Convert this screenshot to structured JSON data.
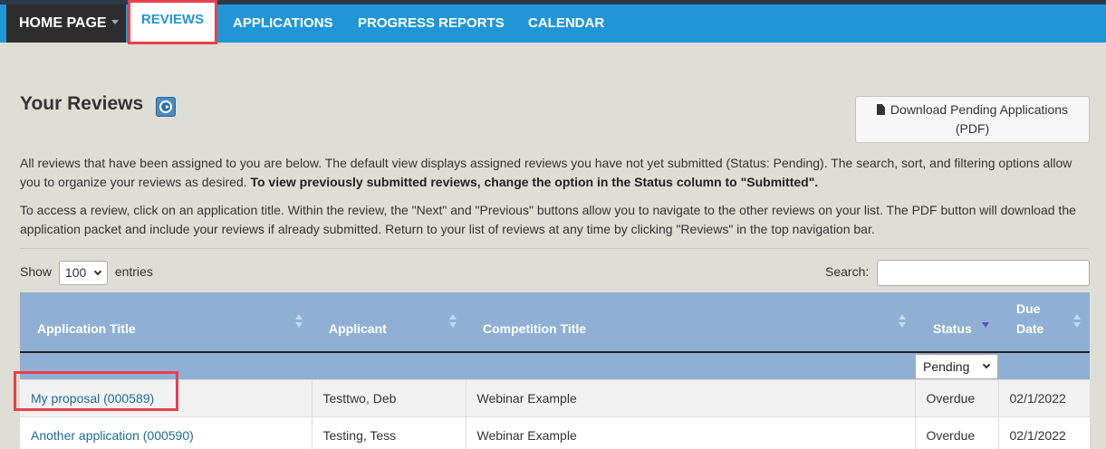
{
  "nav": {
    "home_label": "HOME PAGE",
    "items": [
      "REVIEWS",
      "APPLICATIONS",
      "PROGRESS REPORTS",
      "CALENDAR"
    ]
  },
  "page": {
    "title": "Your Reviews",
    "download_button": {
      "line1": "Download Pending Applications",
      "line2": "(PDF)"
    },
    "para1_text": "All reviews that have been assigned to you are below. The default view displays assigned reviews you have not yet submitted (Status: Pending). The search, sort, and filtering options allow you to organize your reviews as desired. ",
    "para1_bold": "To view previously submitted reviews, change the option in the Status column to \"Submitted\".",
    "para2_text": "To access a review, click on an application title. Within the review, the \"Next\" and \"Previous\" buttons allow you to navigate to the other reviews on your list. The PDF button will download the application packet and include your reviews if already submitted. Return to your list of reviews at any time by clicking \"Reviews\" in the top navigation bar."
  },
  "controls": {
    "show_label": "Show",
    "entries_value": "100",
    "entries_label": "entries",
    "search_label": "Search:",
    "search_value": ""
  },
  "table": {
    "headers": {
      "application_title": "Application Title",
      "applicant": "Applicant",
      "competition_title": "Competition Title",
      "status": "Status",
      "due_line1": "Due",
      "due_line2": "Date"
    },
    "status_filter": "Pending",
    "rows": [
      {
        "title": "My proposal (000589)",
        "applicant": "Testtwo, Deb",
        "competition": "Webinar Example",
        "status": "Overdue",
        "due": "02/1/2022"
      },
      {
        "title": "Another application (000590)",
        "applicant": "Testing, Tess",
        "competition": "Webinar Example",
        "status": "Overdue",
        "due": "02/1/2022"
      }
    ]
  },
  "colors": {
    "navbar": "#2196d6",
    "home": "#2d2d2d",
    "highlight": "#e8414d",
    "table_header": "#8fb0d4",
    "link": "#1c6aa0"
  },
  "icons": [
    "play-video-icon",
    "document-icon",
    "sort-icon",
    "chevron-down-icon"
  ]
}
